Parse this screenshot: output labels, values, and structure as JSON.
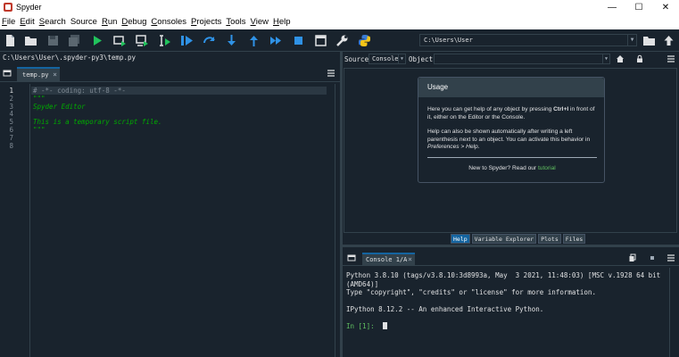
{
  "window": {
    "title": "Spyder",
    "minimize": "—",
    "maximize": "☐",
    "close": "✕"
  },
  "menu": [
    {
      "label": "File",
      "u": "F",
      "rest": "ile"
    },
    {
      "label": "Edit",
      "u": "E",
      "rest": "dit"
    },
    {
      "label": "Search",
      "u": "S",
      "rest": "earch"
    },
    {
      "label": "Source",
      "u": "",
      "rest": "Source"
    },
    {
      "label": "Run",
      "u": "R",
      "rest": "un"
    },
    {
      "label": "Debug",
      "u": "D",
      "rest": "ebug"
    },
    {
      "label": "Consoles",
      "u": "C",
      "rest": "onsoles"
    },
    {
      "label": "Projects",
      "u": "P",
      "rest": "rojects"
    },
    {
      "label": "Tools",
      "u": "T",
      "rest": "ools"
    },
    {
      "label": "View",
      "u": "V",
      "rest": "iew"
    },
    {
      "label": "Help",
      "u": "H",
      "rest": "elp"
    }
  ],
  "toolbar": {
    "working_directory": "C:\\Users\\User"
  },
  "editor": {
    "file_path": "C:\\Users\\User\\.spyder-py3\\temp.py",
    "tab_label": "temp.py",
    "tab_close": "×",
    "line_numbers": [
      "1",
      "2",
      "3",
      "4",
      "5",
      "6",
      "7",
      "8"
    ],
    "lines": [
      {
        "text": "# -*- coding: utf-8 -*-",
        "color": "#7f8a94",
        "italic": false
      },
      {
        "text": "\"\"\"",
        "color": "#00aa00",
        "italic": false
      },
      {
        "text": "Spyder Editor",
        "color": "#00aa00",
        "italic": true
      },
      {
        "text": "",
        "color": "#00aa00",
        "italic": false
      },
      {
        "text": "This is a temporary script file.",
        "color": "#00aa00",
        "italic": true
      },
      {
        "text": "\"\"\"",
        "color": "#00aa00",
        "italic": false
      },
      {
        "text": "",
        "color": "#e0e1e3",
        "italic": false
      },
      {
        "text": "",
        "color": "#e0e1e3",
        "italic": false
      }
    ]
  },
  "help": {
    "source_label": "Source",
    "source_value": "Console",
    "object_label": "Object",
    "object_value": "",
    "usage_title": "Usage",
    "p1_pre": "Here you can get help of any object by pressing ",
    "p1_key": "Ctrl+I",
    "p1_post": " in front of it, either on the Editor or the Console.",
    "p2_pre": "Help can also be shown automatically after writing a left parenthesis next to an object. You can activate this behavior in ",
    "p2_em": "Preferences > Help",
    "p2_post": ".",
    "footer_pre": "New to Spyder? Read our ",
    "footer_link": "tutorial",
    "tabs": [
      "Help",
      "Variable Explorer",
      "Plots",
      "Files"
    ]
  },
  "console": {
    "tab_label": "Console 1/A",
    "tab_close": "×",
    "lines": [
      "Python 3.8.10 (tags/v3.8.10:3d8993a, May  3 2021, 11:48:03) [MSC v.1928 64 bit",
      "(AMD64)]",
      "Type \"copyright\", \"credits\" or \"license\" for more information.",
      "",
      "IPython 8.12.2 -- An enhanced Interactive Python.",
      "",
      "In [1]:"
    ]
  },
  "colors": {
    "background": "#19232d",
    "border": "#32414b",
    "accent": "#1464a0",
    "toolbar_icon": "#e0e1e3",
    "run_icon": "#21c35c",
    "debug_icon": "#2f92e6",
    "prompt_green": "#60c060"
  }
}
